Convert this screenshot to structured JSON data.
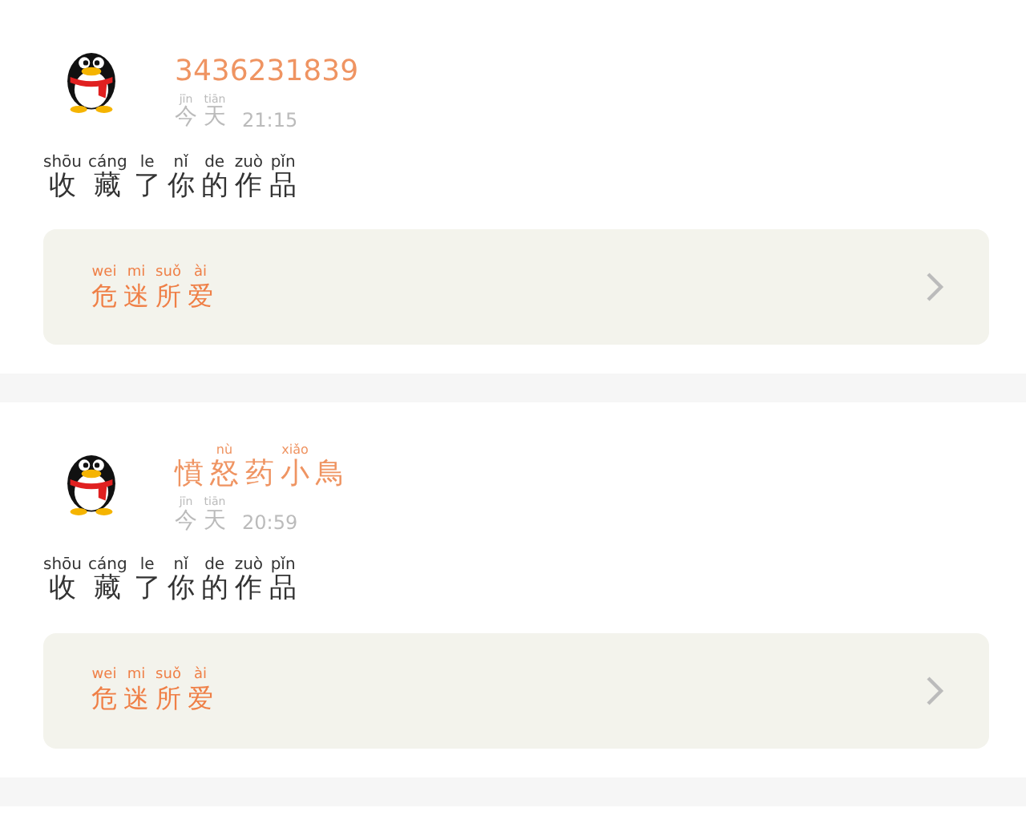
{
  "posts": [
    {
      "author": [
        {
          "char": "3436231839"
        }
      ],
      "date": [
        {
          "char": "今",
          "pinyin": "jīn"
        },
        {
          "char": "天",
          "pinyin": "tiān"
        }
      ],
      "time": "21:15",
      "action": [
        {
          "char": "收",
          "pinyin": "shōu"
        },
        {
          "char": "藏",
          "pinyin": "cáng"
        },
        {
          "char": "了",
          "pinyin": "le"
        },
        {
          "char": "你",
          "pinyin": "nǐ"
        },
        {
          "char": "的",
          "pinyin": "de"
        },
        {
          "char": "作",
          "pinyin": "zuò"
        },
        {
          "char": "品",
          "pinyin": "pǐn"
        }
      ],
      "work": [
        {
          "char": "危",
          "pinyin": "wei"
        },
        {
          "char": "迷",
          "pinyin": "mi"
        },
        {
          "char": "所",
          "pinyin": "suǒ"
        },
        {
          "char": "爱",
          "pinyin": "ài"
        }
      ]
    },
    {
      "author": [
        {
          "char": "憤"
        },
        {
          "char": "怒",
          "pinyin": "nù"
        },
        {
          "char": "药"
        },
        {
          "char": "小",
          "pinyin": "xiǎo"
        },
        {
          "char": "鳥"
        }
      ],
      "date": [
        {
          "char": "今",
          "pinyin": "jīn"
        },
        {
          "char": "天",
          "pinyin": "tiān"
        }
      ],
      "time": "20:59",
      "action": [
        {
          "char": "收",
          "pinyin": "shōu"
        },
        {
          "char": "藏",
          "pinyin": "cáng"
        },
        {
          "char": "了",
          "pinyin": "le"
        },
        {
          "char": "你",
          "pinyin": "nǐ"
        },
        {
          "char": "的",
          "pinyin": "de"
        },
        {
          "char": "作",
          "pinyin": "zuò"
        },
        {
          "char": "品",
          "pinyin": "pǐn"
        }
      ],
      "work": [
        {
          "char": "危",
          "pinyin": "wei"
        },
        {
          "char": "迷",
          "pinyin": "mi"
        },
        {
          "char": "所",
          "pinyin": "suǒ"
        },
        {
          "char": "爱",
          "pinyin": "ài"
        }
      ]
    }
  ]
}
